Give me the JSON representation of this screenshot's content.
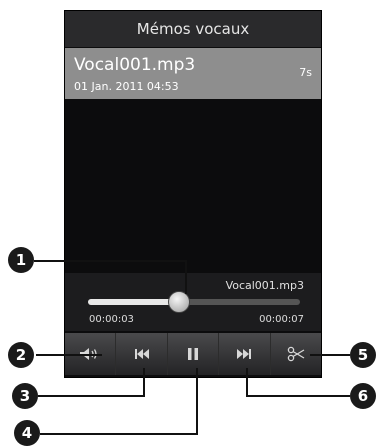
{
  "app": {
    "title": "Mémos vocaux"
  },
  "recording": {
    "name": "Vocal001.mp3",
    "date": "01 Jan. 2011 04:53",
    "duration": "7s"
  },
  "player": {
    "now_playing": "Vocal001.mp3",
    "elapsed": "00:00:03",
    "total": "00:00:07",
    "progress": 0.43
  },
  "controls": [
    {
      "icon": "volume-icon"
    },
    {
      "icon": "previous-icon"
    },
    {
      "icon": "pause-icon"
    },
    {
      "icon": "next-icon"
    },
    {
      "icon": "scissors-icon"
    }
  ],
  "callouts": [
    "1",
    "2",
    "3",
    "4",
    "5",
    "6"
  ],
  "colors": {
    "header": "#2a2a2c",
    "selected_row": "#8e8e8e",
    "screen_bg": "#0c0c0d"
  }
}
